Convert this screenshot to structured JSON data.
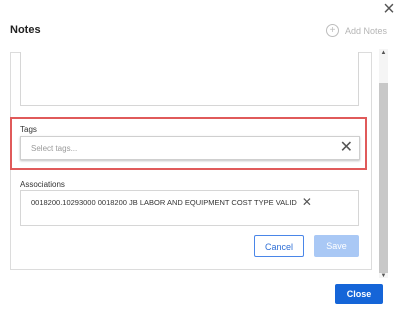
{
  "dialog": {
    "title": "Notes",
    "add_notes_label": "Add Notes",
    "close_icon": "close-icon",
    "add_icon": "plus-circle-icon"
  },
  "tags": {
    "label": "Tags",
    "placeholder": "Select tags...",
    "clear_icon": "close-icon"
  },
  "associations": {
    "label": "Associations",
    "items": [
      {
        "text": "0018200.10293000 0018200 JB LABOR AND EQUIPMENT COST TYPE VALID"
      }
    ],
    "remove_icon": "close-icon"
  },
  "buttons": {
    "cancel": "Cancel",
    "save": "Save",
    "close": "Close"
  },
  "colors": {
    "primary": "#1565d8",
    "save_disabled": "#a9c8f5",
    "highlight": "#e05a5a"
  }
}
